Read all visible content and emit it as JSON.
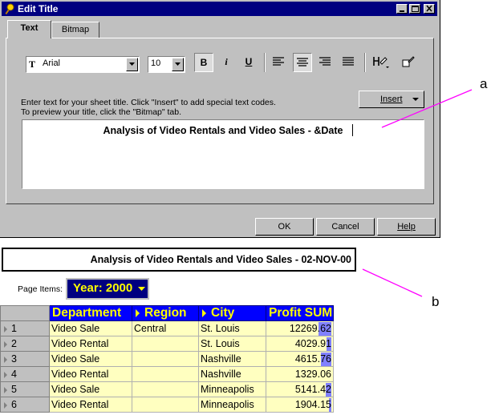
{
  "dialog": {
    "title": "Edit Title",
    "tabs": [
      {
        "label": "Text"
      },
      {
        "label": "Bitmap"
      }
    ],
    "font": {
      "name": "Arial",
      "size": "10"
    },
    "format_buttons": {
      "bold": "B",
      "italic": "i",
      "underline": "U"
    },
    "instructions": [
      "Enter text for your sheet title. Click \"Insert\" to add special text codes.",
      "To preview your title, click the \"Bitmap\" tab."
    ],
    "insert_label": "Insert",
    "title_text": "Analysis of Video Rentals and Video Sales  - &Date",
    "buttons": {
      "ok": "OK",
      "cancel": "Cancel",
      "help": "Help"
    }
  },
  "callouts": {
    "a": "a",
    "b": "b",
    "color": "#ff00ff"
  },
  "report": {
    "title": "Analysis of Video Rentals and Video Sales  - 02-NOV-00",
    "page_items_label": "Page Items:",
    "page_item_value": "Year: 2000",
    "columns": [
      "Department",
      "Region",
      "City",
      "Profit SUM"
    ],
    "rows": [
      {
        "n": "1",
        "department": "Video Sale",
        "region": "Central",
        "city": "St. Louis",
        "profit": "12269.62",
        "bar": 0.19
      },
      {
        "n": "2",
        "department": "Video Rental",
        "region": "",
        "city": "St. Louis",
        "profit": "4029.91",
        "bar": 0.07
      },
      {
        "n": "3",
        "department": "Video Sale",
        "region": "",
        "city": "Nashville",
        "profit": "4615.76",
        "bar": 0.16
      },
      {
        "n": "4",
        "department": "Video Rental",
        "region": "",
        "city": "Nashville",
        "profit": "1329.06",
        "bar": 0.0
      },
      {
        "n": "5",
        "department": "Video Sale",
        "region": "",
        "city": "Minneapolis",
        "profit": "5141.42",
        "bar": 0.08
      },
      {
        "n": "6",
        "department": "Video Rental",
        "region": "",
        "city": "Minneapolis",
        "profit": "1904.15",
        "bar": 0.03
      }
    ],
    "colors": {
      "header_bg": "#0000ff",
      "header_text": "#ffff00",
      "cell_bg": "#ffffc0",
      "bar": "#8080ff"
    }
  }
}
